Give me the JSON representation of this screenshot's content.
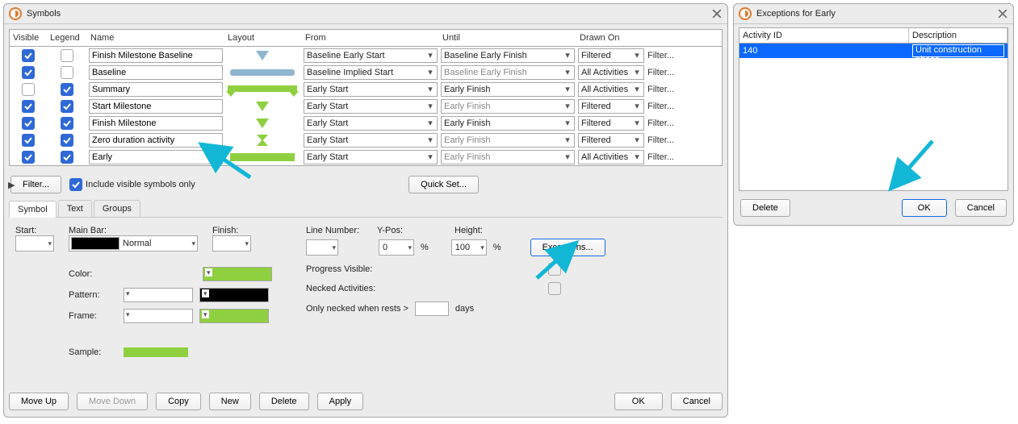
{
  "symbols_window": {
    "title": "Symbols",
    "headers": {
      "visible": "Visible",
      "legend": "Legend",
      "name": "Name",
      "layout": "Layout",
      "from": "From",
      "until": "Until",
      "drawn": "Drawn On"
    },
    "rows": [
      {
        "visible": true,
        "legend": false,
        "name": "Finish Milestone Baseline",
        "layout": "tri-blue",
        "from": "Baseline Early Start",
        "until": "Baseline Early Finish",
        "until_muted": false,
        "drawn": "Filtered",
        "filter": "Filter..."
      },
      {
        "visible": true,
        "legend": false,
        "name": "Baseline",
        "layout": "bar-blue",
        "from": "Baseline Implied Start",
        "until": "Baseline Early Finish",
        "until_muted": true,
        "drawn": "All Activities",
        "filter": "Filter..."
      },
      {
        "visible": false,
        "legend": true,
        "name": "Summary",
        "layout": "summary",
        "from": "Early Start",
        "until": "Early Finish",
        "until_muted": false,
        "drawn": "All Activities",
        "filter": "Filter..."
      },
      {
        "visible": true,
        "legend": true,
        "name": "Start Milestone",
        "layout": "tri-green",
        "from": "Early Start",
        "until": "Early Finish",
        "until_muted": true,
        "drawn": "Filtered",
        "filter": "Filter..."
      },
      {
        "visible": true,
        "legend": true,
        "name": "Finish Milestone",
        "layout": "tri-green",
        "from": "Early Start",
        "until": "Early Finish",
        "until_muted": false,
        "drawn": "Filtered",
        "filter": "Filter..."
      },
      {
        "visible": true,
        "legend": true,
        "name": "Zero duration activity",
        "layout": "zero",
        "from": "Early Start",
        "until": "Early Finish",
        "until_muted": true,
        "drawn": "Filtered",
        "filter": "Filter..."
      },
      {
        "visible": true,
        "legend": true,
        "name": "Early",
        "layout": "bar-green",
        "from": "Early Start",
        "until": "Early Finish",
        "until_muted": true,
        "drawn": "All Activities",
        "filter": "Filter..."
      }
    ],
    "filter_btn": "Filter...",
    "include_visible_label": "Include visible symbols only",
    "include_visible_checked": true,
    "quick_set_btn": "Quick Set...",
    "tabs": {
      "symbol": "Symbol",
      "text": "Text",
      "groups": "Groups"
    },
    "symbol_pane": {
      "start_lbl": "Start:",
      "mainbar_lbl": "Main Bar:",
      "mainbar_mode": "Normal",
      "finish_lbl": "Finish:",
      "color_lbl": "Color:",
      "pattern_lbl": "Pattern:",
      "frame_lbl": "Frame:",
      "sample_lbl": "Sample:",
      "line_lbl": "Line Number:",
      "ypos_lbl": "Y-Pos:",
      "ypos_val": "0",
      "pct": "%",
      "height_lbl": "Height:",
      "height_val": "100",
      "exceptions_btn": "Exceptions...",
      "progress_lbl": "Progress Visible:",
      "necked_lbl": "Necked Activities:",
      "only_necked_lbl": "Only necked when rests >",
      "days_lbl": "days"
    },
    "footer": {
      "move_up": "Move Up",
      "move_down": "Move Down",
      "copy": "Copy",
      "new": "New",
      "delete": "Delete",
      "apply": "Apply",
      "ok": "OK",
      "cancel": "Cancel"
    }
  },
  "exceptions_window": {
    "title": "Exceptions for Early",
    "headers": {
      "activity_id": "Activity ID",
      "description": "Description"
    },
    "row": {
      "activity_id": "140",
      "description": "Unit construction phase"
    },
    "delete": "Delete",
    "ok": "OK",
    "cancel": "Cancel"
  }
}
